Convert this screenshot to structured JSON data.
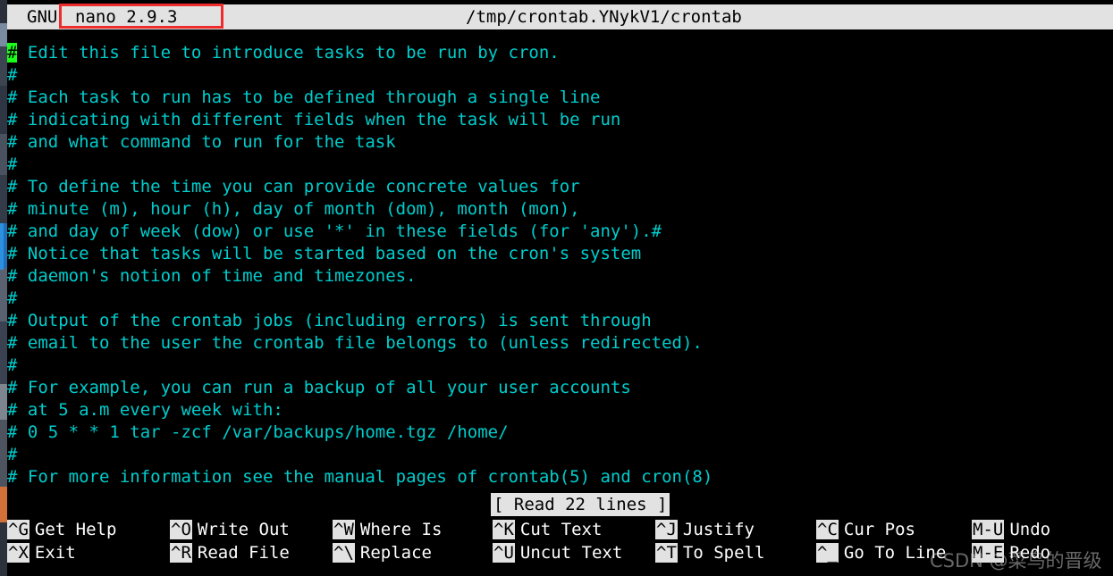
{
  "window": {
    "title_prefix": "GNU",
    "version": "nano 2.9.3",
    "file_path": "/tmp/crontab.YNykV1/crontab"
  },
  "colors": {
    "titlebar_bg": "#e2e2e2",
    "titlebar_fg": "#000000",
    "editor_bg": "#000000",
    "text_cyan": "#00cdcd",
    "cursor_green": "#1aff1a",
    "highlight_red": "#ee2c2c",
    "shortcut_label": "#ffffff"
  },
  "editor": {
    "cursor_char": "#",
    "lines": [
      " Edit this file to introduce tasks to be run by cron.",
      "#",
      "# Each task to run has to be defined through a single line",
      "# indicating with different fields when the task will be run",
      "# and what command to run for the task",
      "#",
      "# To define the time you can provide concrete values for",
      "# minute (m), hour (h), day of month (dom), month (mon),",
      "# and day of week (dow) or use '*' in these fields (for 'any').#",
      "# Notice that tasks will be started based on the cron's system",
      "# daemon's notion of time and timezones.",
      "#",
      "# Output of the crontab jobs (including errors) is sent through",
      "# email to the user the crontab file belongs to (unless redirected).",
      "#",
      "# For example, you can run a backup of all your user accounts",
      "# at 5 a.m every week with:",
      "# 0 5 * * 1 tar -zcf /var/backups/home.tgz /home/",
      "#",
      "# For more information see the manual pages of crontab(5) and cron(8)"
    ]
  },
  "status": {
    "message": "[ Read 22 lines ]"
  },
  "shortcuts": {
    "row1": [
      {
        "key": "^G",
        "label": "Get Help"
      },
      {
        "key": "^O",
        "label": "Write Out"
      },
      {
        "key": "^W",
        "label": "Where Is"
      },
      {
        "key": "^K",
        "label": "Cut Text"
      },
      {
        "key": "^J",
        "label": "Justify"
      },
      {
        "key": "^C",
        "label": "Cur Pos"
      },
      {
        "key": "M-U",
        "label": "Undo"
      }
    ],
    "row2": [
      {
        "key": "^X",
        "label": "Exit"
      },
      {
        "key": "^R",
        "label": "Read File"
      },
      {
        "key": "^\\",
        "label": "Replace"
      },
      {
        "key": "^U",
        "label": "Uncut Text"
      },
      {
        "key": "^T",
        "label": "To Spell"
      },
      {
        "key": "^_",
        "label": "Go To Line"
      },
      {
        "key": "M-E",
        "label": "Redo"
      }
    ]
  },
  "watermark": {
    "text": "CSDN @菜鸟的晋级"
  }
}
